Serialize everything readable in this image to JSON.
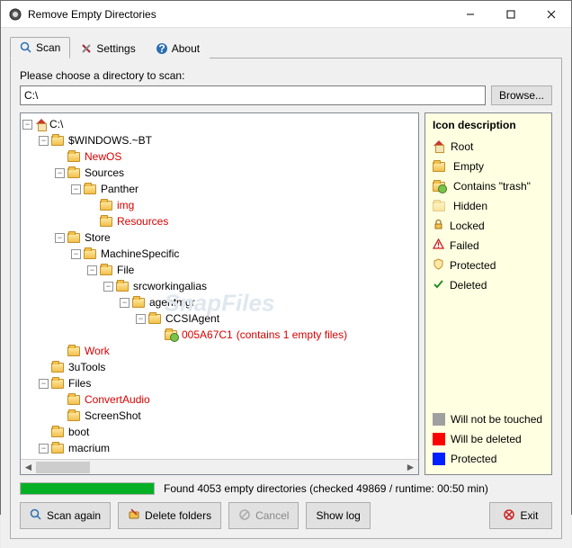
{
  "window": {
    "title": "Remove Empty Directories"
  },
  "tabs": {
    "scan": "Scan",
    "settings": "Settings",
    "about": "About"
  },
  "chooser": {
    "label": "Please choose a directory to scan:",
    "path": "C:\\",
    "browse": "Browse..."
  },
  "tree": [
    {
      "indent": 0,
      "toggle": "-",
      "icon": "house",
      "label": "C:\\",
      "red": false
    },
    {
      "indent": 1,
      "toggle": "-",
      "icon": "folder",
      "label": "$WINDOWS.~BT",
      "red": false
    },
    {
      "indent": 2,
      "toggle": null,
      "icon": "folder",
      "label": "NewOS",
      "red": true
    },
    {
      "indent": 2,
      "toggle": "-",
      "icon": "folder",
      "label": "Sources",
      "red": false
    },
    {
      "indent": 3,
      "toggle": "-",
      "icon": "folder",
      "label": "Panther",
      "red": false
    },
    {
      "indent": 4,
      "toggle": null,
      "icon": "folder",
      "label": "img",
      "red": true
    },
    {
      "indent": 4,
      "toggle": null,
      "icon": "folder",
      "label": "Resources",
      "red": true
    },
    {
      "indent": 2,
      "toggle": "-",
      "icon": "folder",
      "label": "Store",
      "red": false
    },
    {
      "indent": 3,
      "toggle": "-",
      "icon": "folder",
      "label": "MachineSpecific",
      "red": false
    },
    {
      "indent": 4,
      "toggle": "-",
      "icon": "folder",
      "label": "File",
      "red": false
    },
    {
      "indent": 5,
      "toggle": "-",
      "icon": "folder",
      "label": "srcworkingalias",
      "red": false
    },
    {
      "indent": 6,
      "toggle": "-",
      "icon": "folder",
      "label": "agentmgr",
      "red": false
    },
    {
      "indent": 7,
      "toggle": "-",
      "icon": "folder",
      "label": "CCSIAgent",
      "red": false
    },
    {
      "indent": 8,
      "toggle": null,
      "icon": "folder-trash",
      "label": "005A67C1",
      "red": true,
      "info": "(contains 1 empty files)"
    },
    {
      "indent": 2,
      "toggle": null,
      "icon": "folder",
      "label": "Work",
      "red": true
    },
    {
      "indent": 1,
      "toggle": null,
      "icon": "folder",
      "label": "3uTools",
      "red": false
    },
    {
      "indent": 1,
      "toggle": "-",
      "icon": "folder",
      "label": "Files",
      "red": false
    },
    {
      "indent": 2,
      "toggle": null,
      "icon": "folder",
      "label": "ConvertAudio",
      "red": true
    },
    {
      "indent": 2,
      "toggle": null,
      "icon": "folder",
      "label": "ScreenShot",
      "red": false
    },
    {
      "indent": 1,
      "toggle": null,
      "icon": "folder",
      "label": "boot",
      "red": false
    },
    {
      "indent": 1,
      "toggle": "-",
      "icon": "folder",
      "label": "macrium",
      "red": false
    }
  ],
  "legend": {
    "title": "Icon description",
    "items": [
      "Root",
      "Empty",
      "Contains \"trash\"",
      "Hidden",
      "Locked",
      "Failed",
      "Protected",
      "Deleted"
    ],
    "swatches": [
      {
        "color": "#a0a0a0",
        "label": "Will not be touched"
      },
      {
        "color": "#ff0000",
        "label": "Will be deleted"
      },
      {
        "color": "#0020ff",
        "label": "Protected"
      }
    ]
  },
  "status": "Found 4053 empty directories (checked 49869 / runtime: 00:50 min)",
  "progress_pct": 100,
  "buttons": {
    "scan_again": "Scan again",
    "delete": "Delete folders",
    "cancel": "Cancel",
    "show_log": "Show log",
    "exit": "Exit"
  },
  "watermark": "SnapFiles"
}
